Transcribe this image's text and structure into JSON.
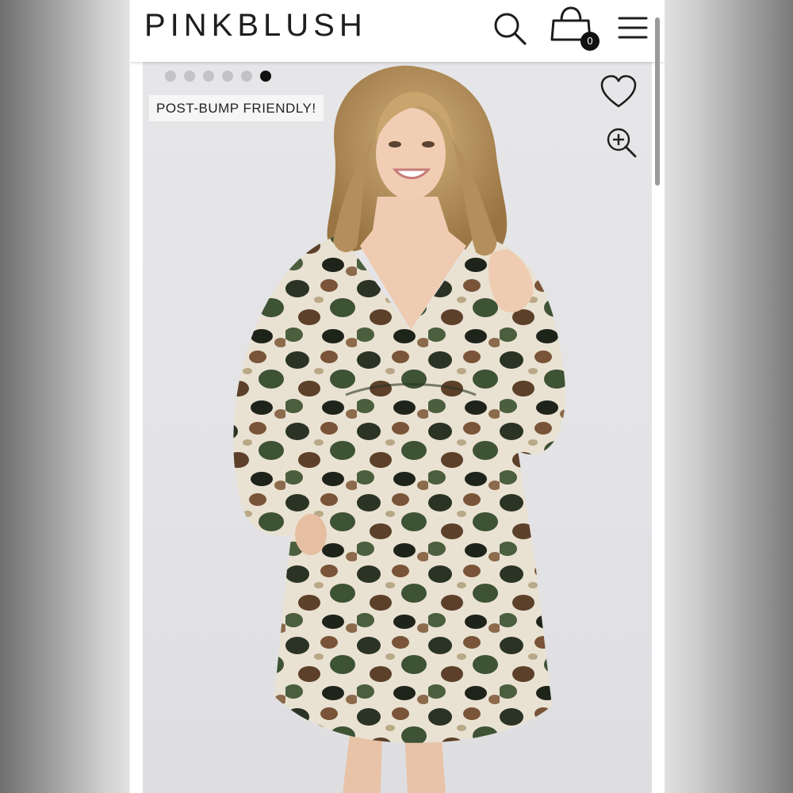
{
  "header": {
    "logo": "PINKBLUSH",
    "search_icon": "search-icon",
    "bag_icon": "shopping-bag-icon",
    "bag_count": "0",
    "menu_icon": "hamburger-menu-icon"
  },
  "product_gallery": {
    "dots_total": 6,
    "active_dot_index": 5,
    "badge": "POST-BUMP FRIENDLY!",
    "wishlist_icon": "heart-icon",
    "zoom_icon": "zoom-in-icon"
  },
  "colors": {
    "background": "#ffffff",
    "text": "#1e1e1e",
    "active_dot": "#111111",
    "inactive_dot": "#c3c3c6"
  }
}
